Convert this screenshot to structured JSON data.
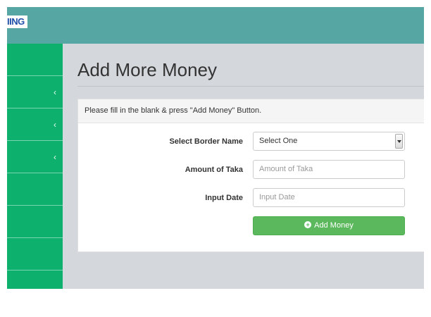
{
  "header": {
    "logo_text": "IING"
  },
  "sidebar": {
    "chevrons": [
      "‹",
      "‹",
      "‹"
    ]
  },
  "page": {
    "title": "Add More Money"
  },
  "panel": {
    "instruction": "Please fill in the blank & press \"Add Money\" Button.",
    "fields": {
      "border": {
        "label": "Select Border Name",
        "value": "Select One"
      },
      "amount": {
        "label": "Amount of Taka",
        "placeholder": "Amount of Taka"
      },
      "date": {
        "label": "Input Date",
        "placeholder": "Input Date"
      }
    },
    "submit": {
      "label": "Add Money",
      "icon": "plus-circle-icon"
    }
  },
  "colors": {
    "topbar": "#56a7a3",
    "sidebar": "#0eb06e",
    "button": "#5cb85c",
    "content_bg": "#d4d7dc"
  }
}
